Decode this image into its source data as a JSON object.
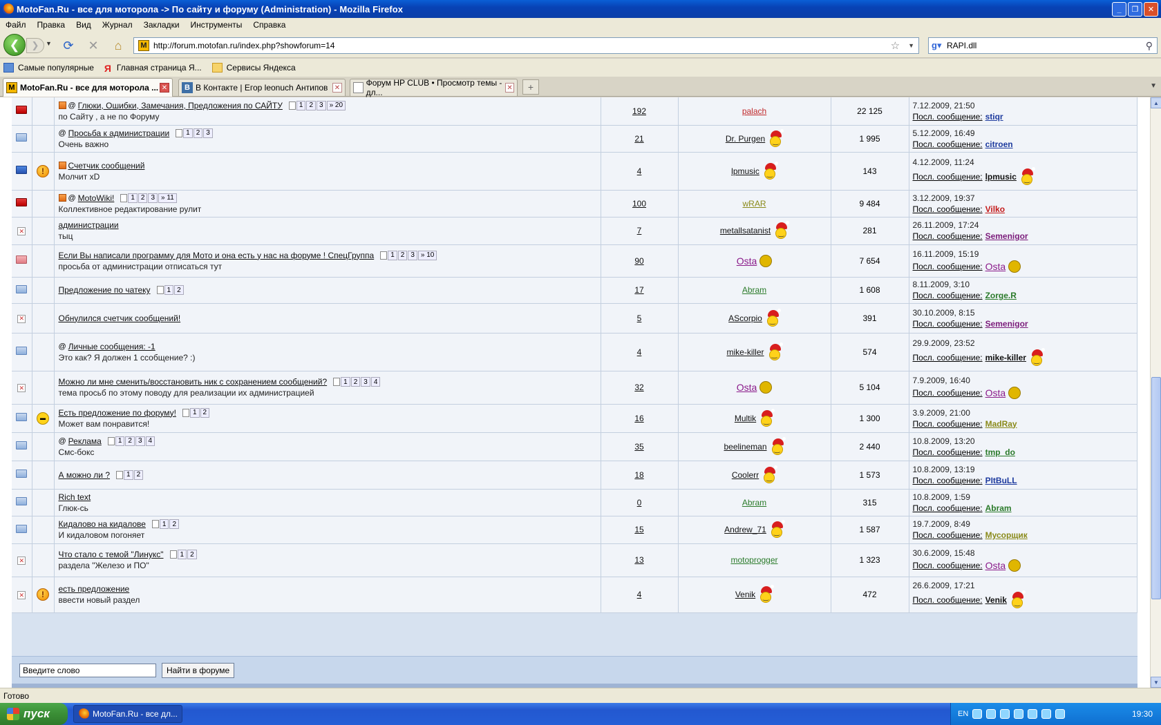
{
  "window": {
    "title": "MotoFan.Ru - все для моторола -> По сайту и форуму (Administration) - Mozilla Firefox",
    "buttons": [
      "_",
      "❐",
      "✕"
    ]
  },
  "menu": [
    "Файл",
    "Правка",
    "Вид",
    "Журнал",
    "Закладки",
    "Инструменты",
    "Справка"
  ],
  "nav": {
    "url": "http://forum.motofan.ru/index.php?showforum=14",
    "search_value": "RAPI.dll"
  },
  "bookmarks": [
    "Самые популярные",
    "Главная страница Я...",
    "Сервисы Яндекса"
  ],
  "tabs": [
    {
      "label": "MotoFan.Ru - все для моторола ...",
      "active": true
    },
    {
      "label": "В Контакте | Егор leonuch Антипов",
      "active": false
    },
    {
      "label": "Форум HP CLUB • Просмотр темы - дл...",
      "active": false
    }
  ],
  "topics": [
    {
      "icon": "folder-red",
      "emoticon": "",
      "hot": true,
      "attach": true,
      "title": "Глюки, Ошибки, Замечания, Предложения по САЙТУ",
      "desc": "по Сайту , а не по Форуму",
      "pages": [
        "1",
        "2",
        "3",
        "» 20"
      ],
      "replies": "192",
      "author": "palach",
      "author_color": "#c0282a",
      "author_santa": false,
      "views": "22 125",
      "last_date": "7.12.2009, 21:50",
      "last_by": "stiqr",
      "last_color": "#1d3a9e",
      "last_santa": false
    },
    {
      "icon": "folder-blue",
      "emoticon": "",
      "hot": false,
      "attach": true,
      "title": "Просьба к администрации",
      "desc": "Очень важно",
      "pages": [
        "1",
        "2",
        "3"
      ],
      "replies": "21",
      "author": "Dr. Purgen",
      "author_color": "#111111",
      "author_santa": true,
      "views": "1 995",
      "last_date": "5.12.2009, 16:49",
      "last_by": "citroen",
      "last_color": "#1d3a9e",
      "last_santa": false
    },
    {
      "icon": "folder-navy",
      "emoticon": "warn",
      "hot": true,
      "attach": false,
      "title": "Счетчик сообщений",
      "desc": "Молчит xD",
      "pages": [],
      "replies": "4",
      "author": "lpmusic",
      "author_color": "#111111",
      "author_santa": true,
      "views": "143",
      "last_date": "4.12.2009, 11:24",
      "last_by": "lpmusic",
      "last_color": "#111111",
      "last_santa": true
    },
    {
      "icon": "folder-red",
      "emoticon": "",
      "hot": true,
      "attach": true,
      "title": "MotoWiki!",
      "desc": "Коллективное редактирование рулит",
      "pages": [
        "1",
        "2",
        "3",
        "» 11"
      ],
      "replies": "100",
      "author": "wRAR",
      "author_color": "#8a8a1a",
      "author_santa": false,
      "views": "9 484",
      "last_date": "3.12.2009, 19:37",
      "last_by": "Vilko",
      "last_color": "#c41a1a",
      "last_santa": false
    },
    {
      "icon": "x",
      "emoticon": "",
      "hot": false,
      "attach": false,
      "title": "администрации",
      "desc": "тыц",
      "pages": [],
      "replies": "7",
      "author": "metallsatanist",
      "author_color": "#111111",
      "author_santa": true,
      "views": "281",
      "last_date": "26.11.2009, 17:24",
      "last_by": "Semenigor",
      "last_color": "#7a1a7a",
      "last_santa": false
    },
    {
      "icon": "folder-pink",
      "emoticon": "",
      "hot": false,
      "attach": false,
      "title": "Если Вы написали программу для Мото и она есть у нас на форуме ! СпецГруппа",
      "desc": "просьба от администрации отписаться тут",
      "pages": [
        "1",
        "2",
        "3",
        "» 10"
      ],
      "replies": "90",
      "author": "Osta",
      "author_color": "#8a1a8a",
      "author_santa": false,
      "views": "7 654",
      "last_date": "16.11.2009, 15:19",
      "last_by": "Osta",
      "last_color": "#8a1a8a",
      "last_santa": false
    },
    {
      "icon": "folder-blue",
      "emoticon": "",
      "hot": false,
      "attach": false,
      "title": "Предложение по чатеку",
      "desc": "",
      "pages": [
        "1",
        "2"
      ],
      "replies": "17",
      "author": "Abram",
      "author_color": "#2a7a2a",
      "author_santa": false,
      "views": "1 608",
      "last_date": "8.11.2009, 3:10",
      "last_by": "Zorge.R",
      "last_color": "#2a7a2a",
      "last_santa": false
    },
    {
      "icon": "x",
      "emoticon": "",
      "hot": false,
      "attach": false,
      "title": "Обнулился счетчик сообщений!",
      "desc": "",
      "pages": [],
      "replies": "5",
      "author": "AScorpio",
      "author_color": "#111111",
      "author_santa": true,
      "views": "391",
      "last_date": "30.10.2009, 8:15",
      "last_by": "Semenigor",
      "last_color": "#7a1a7a",
      "last_santa": false
    },
    {
      "icon": "folder-blue",
      "emoticon": "",
      "hot": false,
      "attach": true,
      "title": "Личные сообщения: -1",
      "desc": "Это как? Я должен 1 ссобщение? :)",
      "pages": [],
      "replies": "4",
      "author": "mike-killer",
      "author_color": "#111111",
      "author_santa": true,
      "views": "574",
      "last_date": "29.9.2009, 23:52",
      "last_by": "mike-killer",
      "last_color": "#111111",
      "last_santa": true
    },
    {
      "icon": "x",
      "emoticon": "",
      "hot": false,
      "attach": false,
      "title": "Можно ли мне сменить/восстановить ник с сохранением сообщений?",
      "desc": "тема просьб по этому поводу для реализации их администрацией",
      "pages": [
        "1",
        "2",
        "3",
        "4"
      ],
      "replies": "32",
      "author": "Osta",
      "author_color": "#8a1a8a",
      "author_santa": false,
      "views": "5 104",
      "last_date": "7.9.2009, 16:40",
      "last_by": "Osta",
      "last_color": "#8a1a8a",
      "last_santa": false
    },
    {
      "icon": "folder-blue",
      "emoticon": "cool",
      "hot": false,
      "attach": false,
      "title": "Есть предложение по форуму!",
      "desc": "Может вам понравится!",
      "pages": [
        "1",
        "2"
      ],
      "replies": "16",
      "author": "Multik",
      "author_color": "#111111",
      "author_santa": true,
      "views": "1 300",
      "last_date": "3.9.2009, 21:00",
      "last_by": "MadRay",
      "last_color": "#8a8a1a",
      "last_santa": false
    },
    {
      "icon": "folder-blue",
      "emoticon": "",
      "hot": false,
      "attach": true,
      "title": "Реклама",
      "desc": "Смс-бокс",
      "pages": [
        "1",
        "2",
        "3",
        "4"
      ],
      "replies": "35",
      "author": "beelineman",
      "author_color": "#111111",
      "author_santa": true,
      "views": "2 440",
      "last_date": "10.8.2009, 13:20",
      "last_by": "tmp_do",
      "last_color": "#2a7a2a",
      "last_santa": false
    },
    {
      "icon": "folder-blue",
      "emoticon": "",
      "hot": false,
      "attach": false,
      "title": "А можно ли ?",
      "desc": "",
      "pages": [
        "1",
        "2"
      ],
      "replies": "18",
      "author": "Coolerr",
      "author_color": "#111111",
      "author_santa": true,
      "views": "1 573",
      "last_date": "10.8.2009, 13:19",
      "last_by": "PItBuLL",
      "last_color": "#1d3a9e",
      "last_santa": false
    },
    {
      "icon": "folder-blue",
      "emoticon": "",
      "hot": false,
      "attach": false,
      "title": "Rich text",
      "desc": "Глюк-сь",
      "pages": [],
      "replies": "0",
      "author": "Abram",
      "author_color": "#2a7a2a",
      "author_santa": false,
      "views": "315",
      "last_date": "10.8.2009, 1:59",
      "last_by": "Abram",
      "last_color": "#2a7a2a",
      "last_santa": false
    },
    {
      "icon": "folder-blue",
      "emoticon": "",
      "hot": false,
      "attach": false,
      "title": "Кидалово на кидалове",
      "desc": "И кидаловом погоняет",
      "pages": [
        "1",
        "2"
      ],
      "replies": "15",
      "author": "Andrew_71",
      "author_color": "#111111",
      "author_santa": true,
      "views": "1 587",
      "last_date": "19.7.2009, 8:49",
      "last_by": "Мусорщик",
      "last_color": "#8a8a1a",
      "last_santa": false
    },
    {
      "icon": "x",
      "emoticon": "",
      "hot": false,
      "attach": false,
      "title": "Что стало с темой \"Линукс\"",
      "desc": "раздела \"Железо и ПО\"",
      "pages": [
        "1",
        "2"
      ],
      "replies": "13",
      "author": "motoprogger",
      "author_color": "#2a7a2a",
      "author_santa": false,
      "views": "1 323",
      "last_date": "30.6.2009, 15:48",
      "last_by": "Osta",
      "last_color": "#8a1a8a",
      "last_santa": false
    },
    {
      "icon": "x",
      "emoticon": "warn",
      "hot": false,
      "attach": false,
      "title": "есть предложение",
      "desc": "ввести новый раздел",
      "pages": [],
      "replies": "4",
      "author": "Venik",
      "author_color": "#111111",
      "author_santa": true,
      "views": "472",
      "last_date": "26.6.2009, 17:21",
      "last_by": "Venik",
      "last_color": "#111111",
      "last_santa": true
    }
  ],
  "last_post_label": "Посл. сообщение:",
  "forum_search": {
    "value": "Введите слово",
    "button": "Найти в форуме"
  },
  "status": "Готово",
  "taskbar": {
    "start": "пуск",
    "item": "MotoFan.Ru - все дл...",
    "lang": "EN",
    "clock": "19:30"
  }
}
